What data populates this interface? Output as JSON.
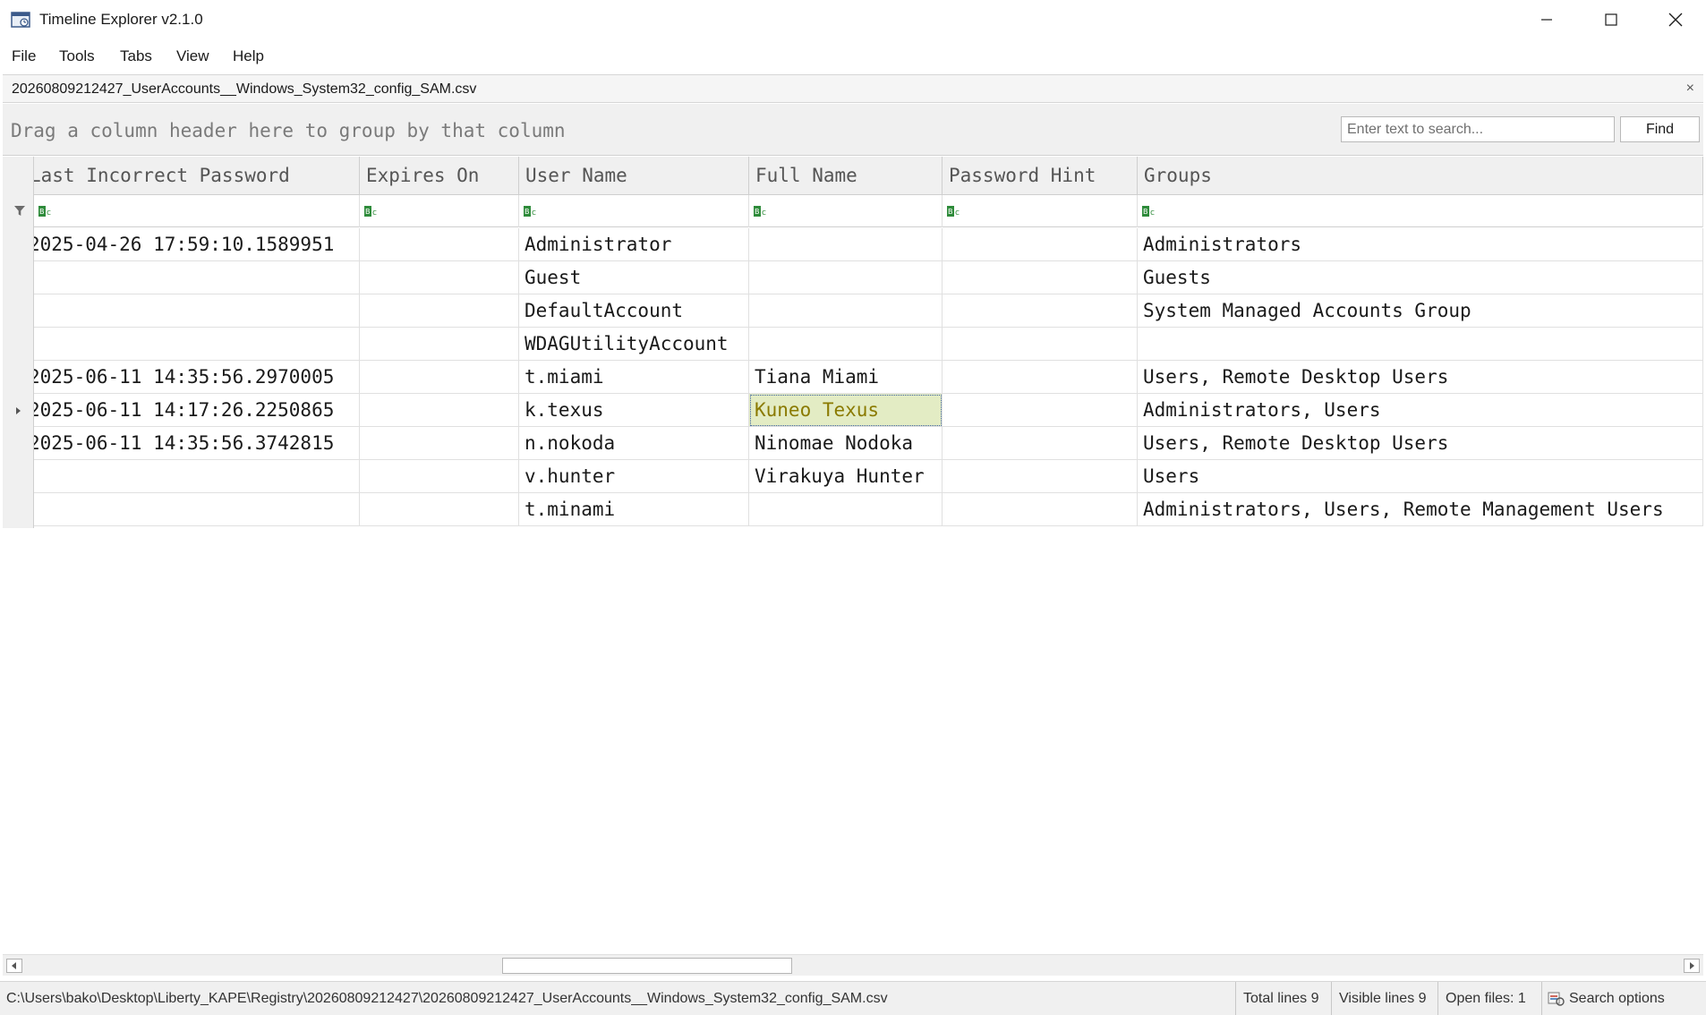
{
  "window": {
    "title": "Timeline Explorer v2.1.0"
  },
  "menu": {
    "file": "File",
    "tools": "Tools",
    "tabs": "Tabs",
    "view": "View",
    "help": "Help"
  },
  "tab": {
    "label": "20260809212427_UserAccounts__Windows_System32_config_SAM.csv",
    "close": "×"
  },
  "grouppanel": {
    "hint": "Drag a column header here to group by that column",
    "search_placeholder": "Enter text to search...",
    "find_label": "Find"
  },
  "grid": {
    "columns": [
      "Last Incorrect Password",
      "Expires On",
      "User Name",
      "Full Name",
      "Password Hint",
      "Groups"
    ],
    "rows": [
      [
        "2025-04-26 17:59:10.1589951",
        "",
        "Administrator",
        "",
        "",
        "Administrators"
      ],
      [
        "",
        "",
        "Guest",
        "",
        "",
        "Guests"
      ],
      [
        "",
        "",
        "DefaultAccount",
        "",
        "",
        "System Managed Accounts Group"
      ],
      [
        "",
        "",
        "WDAGUtilityAccount",
        "",
        "",
        ""
      ],
      [
        "2025-06-11 14:35:56.2970005",
        "",
        "t.miami",
        "Tiana Miami",
        "",
        "Users, Remote Desktop Users"
      ],
      [
        "2025-06-11 14:17:26.2250865",
        "",
        "k.texus",
        "Kuneo Texus",
        "",
        "Administrators, Users"
      ],
      [
        "2025-06-11 14:35:56.3742815",
        "",
        "n.nokoda",
        "Ninomae Nodoka",
        "",
        "Users, Remote Desktop Users"
      ],
      [
        "",
        "",
        "v.hunter",
        "Virakuya Hunter",
        "",
        "Users"
      ],
      [
        "",
        "",
        "t.minami",
        "",
        "",
        "Administrators, Users, Remote Management Users"
      ]
    ],
    "current_row": 5,
    "selected_column": 3
  },
  "status": {
    "path": "C:\\Users\\bako\\Desktop\\Liberty_KAPE\\Registry\\20260809212427\\20260809212427_UserAccounts__Windows_System32_config_SAM.csv",
    "total_lines": "Total lines 9",
    "visible_lines": "Visible lines 9",
    "open_files": "Open files: 1",
    "search_options": "Search options"
  },
  "colors": {
    "selected_cell_bg": "#e3ecc4",
    "abc_icon_green": "#2e8b3a"
  }
}
